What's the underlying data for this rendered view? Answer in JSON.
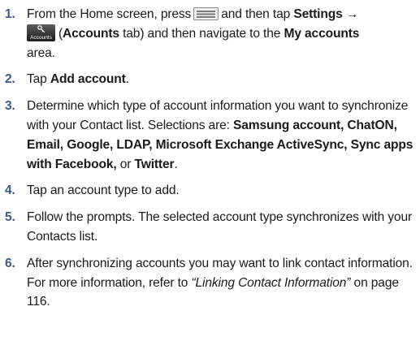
{
  "steps": [
    {
      "number": "1.",
      "t1": "From the Home screen, press",
      "icon_menu": "menu-key-icon",
      "t2": "and then tap",
      "b1": "Settings",
      "arrow": "→",
      "icon_accounts_label": "Accounts",
      "t3": "(",
      "b2": "Accounts",
      "t4": "tab) and then navigate to the",
      "b3": "My accounts",
      "t5": "area."
    },
    {
      "number": "2.",
      "t1": "Tap",
      "b1": "Add account",
      "t2": "."
    },
    {
      "number": "3.",
      "t1": "Determine which type of account information you want to synchronize with your Contact list. Selections are:",
      "b1": "Samsung account, ChatON, Email, Google, LDAP, Microsoft Exchange ActiveSync, Sync apps with Facebook,",
      "t2": "or",
      "b2": "Twitter",
      "t3": "."
    },
    {
      "number": "4.",
      "t1": "Tap an account type to add."
    },
    {
      "number": "5.",
      "t1": "Follow the prompts. The selected account type synchronizes with your Contacts list."
    },
    {
      "number": "6.",
      "t1": "After synchronizing accounts you may want to link contact information. For more information, refer to",
      "i1": "“Linking Contact Information”",
      "t2": "on page 116."
    }
  ]
}
